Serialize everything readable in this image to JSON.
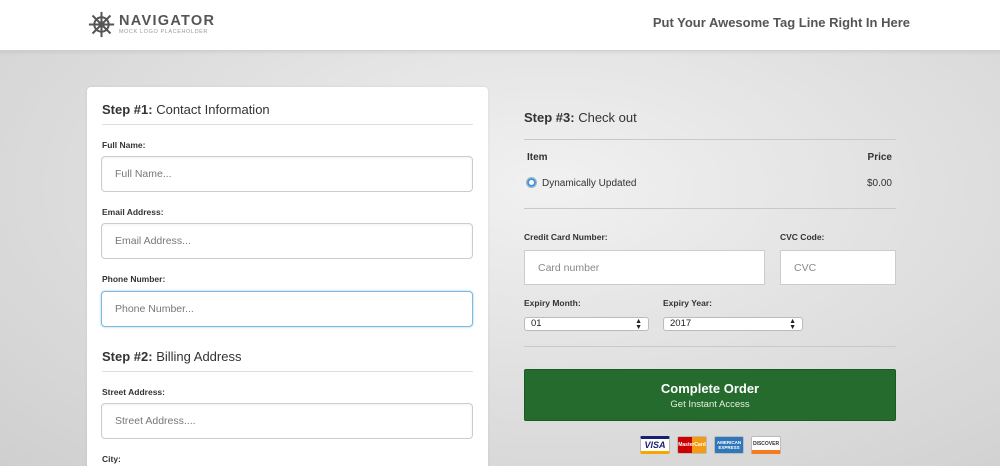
{
  "header": {
    "logo_title": "NAVIGATOR",
    "logo_subtitle": "MOCK LOGO PLACEHOLDER",
    "tagline": "Put Your Awesome Tag Line Right In Here"
  },
  "step1": {
    "number": "Step #1:",
    "title": "Contact Information",
    "fields": {
      "full_name": {
        "label": "Full Name:",
        "placeholder": "Full Name..."
      },
      "email": {
        "label": "Email Address:",
        "placeholder": "Email Address..."
      },
      "phone": {
        "label": "Phone Number:",
        "placeholder": "Phone Number..."
      }
    }
  },
  "step2": {
    "number": "Step #2:",
    "title": "Billing Address",
    "fields": {
      "street": {
        "label": "Street Address:",
        "placeholder": "Street Address...."
      },
      "city": {
        "label": "City:"
      }
    }
  },
  "step3": {
    "number": "Step #3:",
    "title": "Check out",
    "table": {
      "col_item": "Item",
      "col_price": "Price",
      "row_item": "Dynamically Updated",
      "row_price": "$0.00"
    },
    "card_number": {
      "label": "Credit Card Number:",
      "placeholder": "Card number"
    },
    "cvc": {
      "label": "CVC Code:",
      "placeholder": "CVC"
    },
    "expiry_month": {
      "label": "Expiry Month:",
      "value": "01"
    },
    "expiry_year": {
      "label": "Expiry Year:",
      "value": "2017"
    },
    "submit": {
      "main": "Complete Order",
      "sub": "Get Instant Access"
    },
    "payment_icons": {
      "visa": "VISA",
      "mastercard": "MasterCard",
      "amex": "AMERICAN EXPRESS",
      "discover": "DISCOVER"
    }
  },
  "colors": {
    "submit_button": "#266b2e",
    "focus_border": "#7fb8d8",
    "radio_accent": "#4a90e2"
  }
}
